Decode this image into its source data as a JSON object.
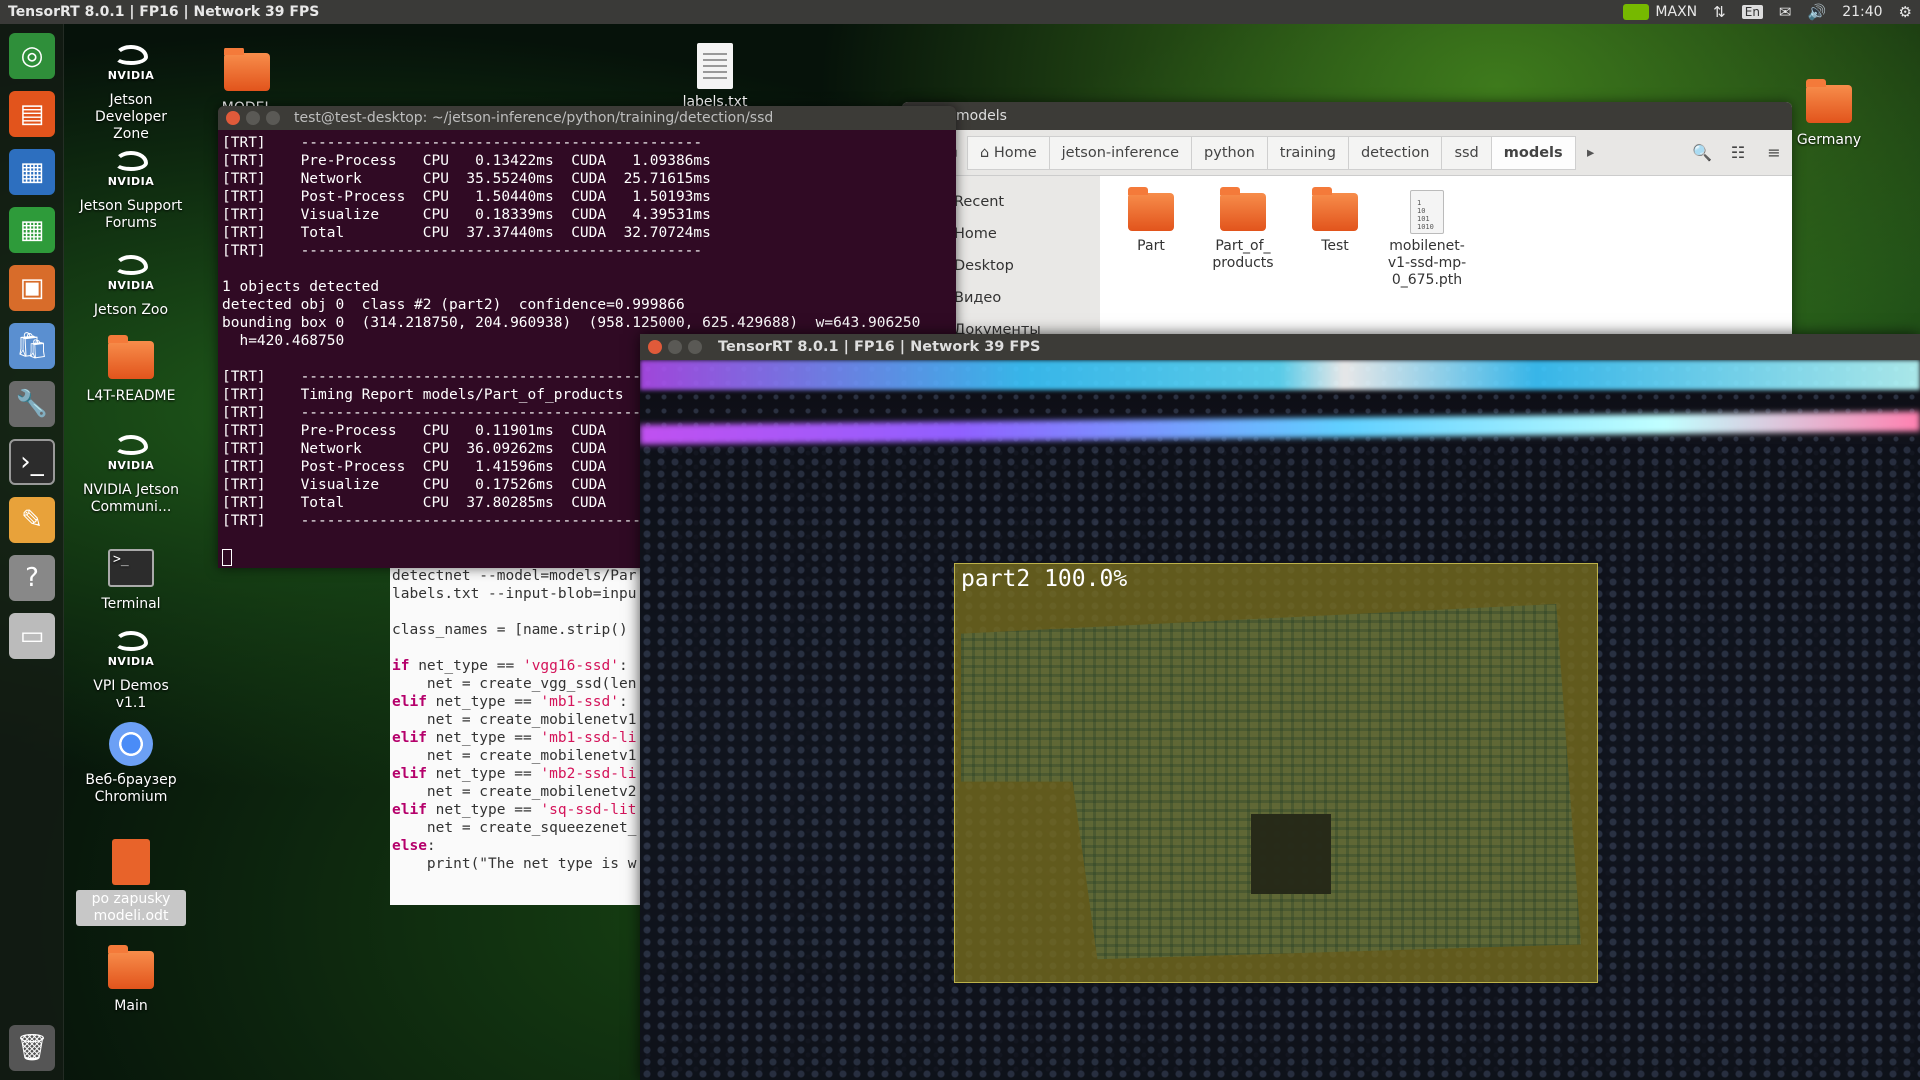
{
  "top_panel": {
    "title": "TensorRT 8.0.1 | FP16 | Network 39 FPS",
    "power_mode": "MAXN",
    "keyboard_layout": "En",
    "clock": "21:40"
  },
  "launcher": {
    "items": [
      "ubuntu-dash",
      "files",
      "writer",
      "calc",
      "impress",
      "software-center",
      "system-settings",
      "terminal",
      "text-editor",
      "help",
      "drive",
      "trash"
    ]
  },
  "desktop_icons": [
    {
      "label": "Jetson Developer Zone",
      "kind": "nvidia"
    },
    {
      "label": "Jetson Support Forums",
      "kind": "nvidia"
    },
    {
      "label": "Jetson Zoo",
      "kind": "nvidia"
    },
    {
      "label": "L4T-README",
      "kind": "folder"
    },
    {
      "label": "NVIDIA Jetson Communi...",
      "kind": "nvidia"
    },
    {
      "label": "Terminal",
      "kind": "terminal"
    },
    {
      "label": "VPI Demos v1.1",
      "kind": "nvidia"
    },
    {
      "label": "Веб-браузер Chromium",
      "kind": "chromium"
    },
    {
      "label": "po zapusky modeli.odt",
      "kind": "document"
    },
    {
      "label": "Main",
      "kind": "folder"
    },
    {
      "label": "MODEL",
      "kind": "folder"
    },
    {
      "label": "labels.txt",
      "kind": "text"
    },
    {
      "label": "Germany",
      "kind": "folder"
    }
  ],
  "terminal": {
    "title": "test@test-desktop: ~/jetson-inference/python/training/detection/ssd",
    "lines": [
      "[TRT]    ----------------------------------------------",
      "[TRT]    Pre-Process   CPU   0.13422ms  CUDA   1.09386ms",
      "[TRT]    Network       CPU  35.55240ms  CUDA  25.71615ms",
      "[TRT]    Post-Process  CPU   1.50440ms  CUDA   1.50193ms",
      "[TRT]    Visualize     CPU   0.18339ms  CUDA   4.39531ms",
      "[TRT]    Total         CPU  37.37440ms  CUDA  32.70724ms",
      "[TRT]    ----------------------------------------------",
      "",
      "1 objects detected",
      "detected obj 0  class #2 (part2)  confidence=0.999866",
      "bounding box 0  (314.218750, 204.960938)  (958.125000, 625.429688)  w=643.906250",
      "  h=420.468750",
      "",
      "[TRT]    ----------------------------------------------",
      "[TRT]    Timing Report models/Part_of_products",
      "[TRT]    ----------------------------------------------",
      "[TRT]    Pre-Process   CPU   0.11901ms  CUDA",
      "[TRT]    Network       CPU  36.09262ms  CUDA",
      "[TRT]    Post-Process  CPU   1.41596ms  CUDA",
      "[TRT]    Visualize     CPU   0.17526ms  CUDA",
      "[TRT]    Total         CPU  37.80285ms  CUDA",
      "[TRT]    ----------------------------------------------"
    ]
  },
  "editor": {
    "lines": [
      {
        "t": "detectnet --model=models/Par"
      },
      {
        "t": "labels.txt --input-blob=inpu"
      },
      {
        "t": ""
      },
      {
        "t": "class_names = [name.strip()"
      },
      {
        "t": ""
      },
      {
        "kw": "if",
        "t": " net_type == ",
        "str": "'vgg16-ssd'",
        "tail": ":"
      },
      {
        "t": "    net = create_vgg_ssd(len"
      },
      {
        "kw": "elif",
        "t": " net_type == ",
        "str": "'mb1-ssd'",
        "tail": ":"
      },
      {
        "t": "    net = create_mobilenetv1"
      },
      {
        "kw": "elif",
        "t": " net_type == ",
        "str": "'mb1-ssd-li",
        "tail": ""
      },
      {
        "t": "    net = create_mobilenetv1"
      },
      {
        "kw": "elif",
        "t": " net_type == ",
        "str": "'mb2-ssd-li",
        "tail": ""
      },
      {
        "t": "    net = create_mobilenetv2"
      },
      {
        "kw": "elif",
        "t": " net_type == ",
        "str": "'sq-ssd-lit",
        "tail": ""
      },
      {
        "t": "    net = create_squeezenet_"
      },
      {
        "kw": "else",
        "t": ":",
        "str": "",
        "tail": ""
      },
      {
        "t": "    print(\"The net type is w"
      }
    ]
  },
  "file_manager": {
    "title": "models",
    "breadcrumbs": [
      "Home",
      "jetson-inference",
      "python",
      "training",
      "detection",
      "ssd",
      "models"
    ],
    "sidebar": [
      "Recent",
      "Home",
      "Desktop",
      "Видео",
      "Документы"
    ],
    "items": [
      {
        "label": "Part",
        "kind": "folder"
      },
      {
        "label": "Part_of_ products",
        "kind": "folder"
      },
      {
        "label": "Test",
        "kind": "folder"
      },
      {
        "label": "mobilenet-v1-ssd-mp-0_675.pth",
        "kind": "binary"
      }
    ]
  },
  "inference_window": {
    "title": "TensorRT 8.0.1 | FP16 | Network 39 FPS",
    "detection_label": "part2 100.0%"
  }
}
